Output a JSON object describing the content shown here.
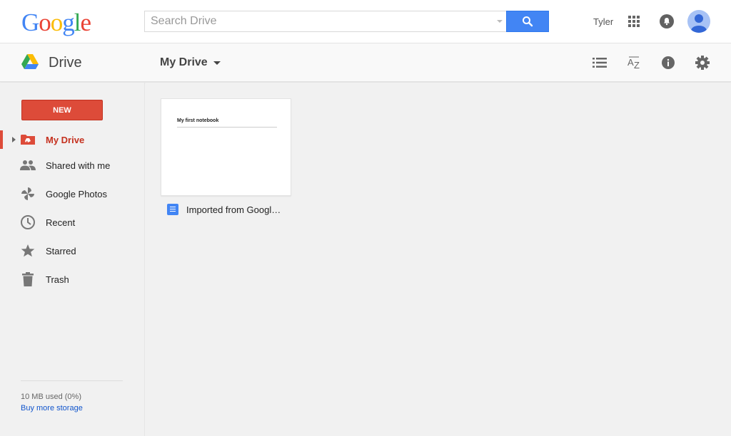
{
  "header": {
    "logo_text": "Google",
    "search_placeholder": "Search Drive",
    "user_name": "Tyler"
  },
  "subheader": {
    "app_name": "Drive",
    "current_folder": "My Drive"
  },
  "sidebar": {
    "new_label": "NEW",
    "items": [
      {
        "label": "My Drive",
        "icon": "drive-folder-icon",
        "active": true
      },
      {
        "label": "Shared with me",
        "icon": "people-icon"
      },
      {
        "label": "Google Photos",
        "icon": "photos-pinwheel-icon"
      },
      {
        "label": "Recent",
        "icon": "clock-icon"
      },
      {
        "label": "Starred",
        "icon": "star-icon"
      },
      {
        "label": "Trash",
        "icon": "trash-icon"
      }
    ],
    "storage_used": "10 MB used (0%)",
    "buy_storage": "Buy more storage"
  },
  "files": [
    {
      "name": "Imported from Googl…",
      "preview_title": "My first notebook",
      "type": "document"
    }
  ],
  "colors": {
    "new_button": "#dd4b39",
    "active_item": "#c5311f",
    "search_button": "#4285f4",
    "link": "#1155cc"
  }
}
